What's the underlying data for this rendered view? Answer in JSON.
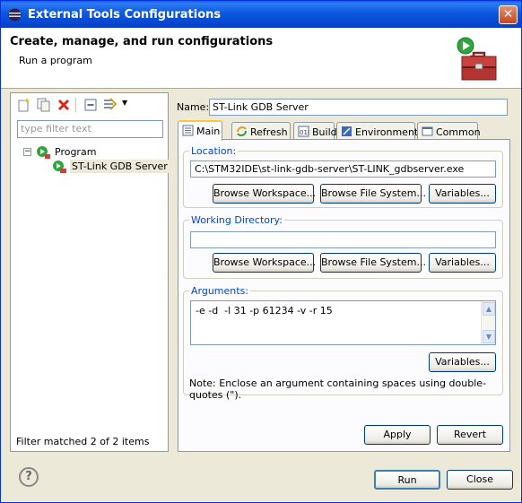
{
  "window": {
    "title": "External Tools Configurations",
    "close_glyph": "✕"
  },
  "header": {
    "title": "Create, manage, and run configurations",
    "message": "Run a program"
  },
  "left": {
    "filter_placeholder": "type filter text",
    "tree": [
      {
        "label": "Program",
        "toggle": "−"
      },
      {
        "label": "ST-Link GDB Server"
      }
    ],
    "status": "Filter matched 2 of 2 items"
  },
  "name": {
    "label": "Name:",
    "value": "ST-Link GDB Server"
  },
  "tabs": [
    {
      "label": "Main",
      "icon": "main-tab-icon"
    },
    {
      "label": "Refresh",
      "icon": "refresh-icon"
    },
    {
      "label": "Build",
      "icon": "build-icon"
    },
    {
      "label": "Environment",
      "icon": "environment-icon"
    },
    {
      "label": "Common",
      "icon": "common-icon"
    }
  ],
  "location": {
    "label": "Location:",
    "value": "C:\\STM32IDE\\st-link-gdb-server\\ST-LINK_gdbserver.exe",
    "browse_workspace": "Browse Workspace...",
    "browse_filesystem": "Browse File System...",
    "variables": "Variables..."
  },
  "working_dir": {
    "label": "Working Directory:",
    "value": "",
    "browse_workspace": "Browse Workspace...",
    "browse_filesystem": "Browse File System...",
    "variables": "Variables..."
  },
  "arguments": {
    "label": "Arguments:",
    "value": "-e -d  -l 31 -p 61234 -v -r 15",
    "variables": "Variables...",
    "note": "Note: Enclose an argument containing spaces using double-quotes (\")."
  },
  "buttons": {
    "apply": "Apply",
    "revert": "Revert",
    "run": "Run",
    "close": "Close",
    "help": "?"
  }
}
